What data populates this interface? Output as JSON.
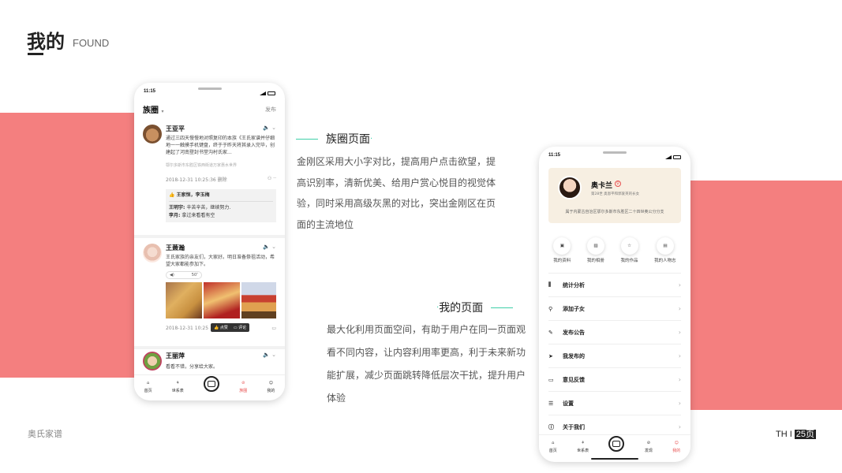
{
  "header": {
    "title": "我的",
    "subtitle": "FOUND"
  },
  "footer": {
    "brand": "奥氏家谱",
    "page_prefix": "TH I",
    "page_num": "25页"
  },
  "colors": {
    "accent_band": "#f47f7f",
    "accent_line": "#3ecfa8",
    "active_tab": "#e85050"
  },
  "section1": {
    "title": "族圈页面",
    "body": "金刚区采用大小字对比，提高用户点击欲望，提高识别率，清新优美、给用户赏心悦目的视觉体验，同时采用高级灰黑的对比，突出金刚区在页面的主流地位"
  },
  "section2": {
    "title": "我的页面",
    "body": "最大化利用页面空间，有助于用户在同一页面观看不同内容，让内容利用率更高，利于未来新功能扩展，减少页面跳转降低层次干扰，提升用户体验"
  },
  "phone1": {
    "time": "11:15",
    "header_title": "族圈",
    "publish": "发布",
    "posts": [
      {
        "name": "王亚平",
        "text": "通过三四天慢慢地对照复印的本族《王氏家谱并仔细地一一触摸手机键盘，终于于昨天将其录入完毕，创建起了河南登封书堂沟村氏家...",
        "location": "鄂尔多斯市东胜区铁西街道万家惠水世界",
        "date": "2018-12-31  10:25:36",
        "delete": "删除",
        "likes": "王家恒，李玉梅",
        "comments": [
          {
            "user": "王明宇:",
            "text": "辛苦辛苦，继续努力."
          },
          {
            "user": "李月:",
            "text": "拿过来看看有空"
          }
        ]
      },
      {
        "name": "王萧瀚",
        "text": "王氏家族的亲友们，大家好。明日准备祭祖活动，希望大家都能参加下。",
        "voice": "50″",
        "date": "2018-12-31  10:25",
        "popover_like": "点赞",
        "popover_comment": "评论"
      },
      {
        "name": "王丽萍",
        "text": "看看不错，分享给大家。"
      }
    ],
    "tabs": [
      "首页",
      "世系表",
      "",
      "族圈",
      "我的"
    ]
  },
  "phone2": {
    "time": "11:15",
    "profile": {
      "name": "奥卡兰",
      "generation": "第28世  奥恩平和郭爱英的长女",
      "desc": "属于内蒙古自治区鄂尔多斯市东胜区二十四世奥公分分支"
    },
    "shortcuts": [
      "我的资料",
      "我的相册",
      "我的作品",
      "我的人物志"
    ],
    "menu": [
      "统计分析",
      "添加子女",
      "发布公告",
      "我发布的",
      "意见反馈",
      "设置",
      "关于我们"
    ],
    "tabs": [
      "首页",
      "世系表",
      "",
      "发现",
      "我的"
    ]
  }
}
